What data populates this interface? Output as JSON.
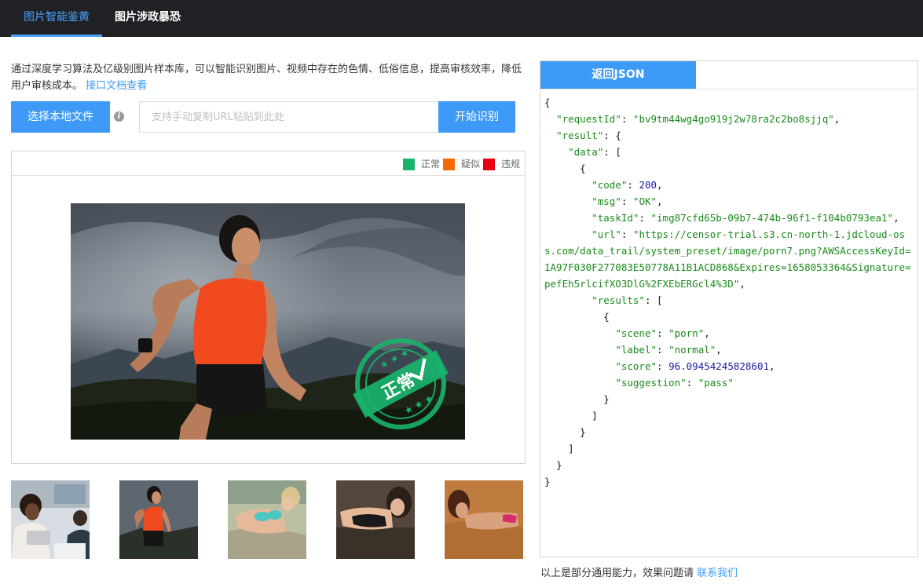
{
  "nav": {
    "tabs": [
      {
        "label": "图片智能鉴黄",
        "active": true
      },
      {
        "label": "图片涉政暴恐",
        "active": false
      }
    ]
  },
  "intro": {
    "text": "通过深度学习算法及亿级别图片样本库，可以智能识别图片、视频中存在的色情、低俗信息，提高审核效率，降低用户审核成本。",
    "link_label": "接口文档查看"
  },
  "controls": {
    "select_file_label": "选择本地文件",
    "info_icon_glyph": "i",
    "url_placeholder": "支持手动复制URL粘贴到此处",
    "url_value": "",
    "start_label": "开始识别"
  },
  "legend": {
    "normal": {
      "label": "正常",
      "color": "#19b36b"
    },
    "suspect": {
      "label": "疑似",
      "color": "#f56a00"
    },
    "violate": {
      "label": "违规",
      "color": "#e60012"
    }
  },
  "stamp": {
    "text": "正常",
    "color": "#19b36b"
  },
  "thumbnails": [
    "office-meeting",
    "runner-orange-top",
    "woman-lying-bra",
    "woman-lying-dark",
    "woman-lying-sand"
  ],
  "json_panel": {
    "tab_label": "返回JSON",
    "lines": [
      [
        {
          "t": "p",
          "v": "{"
        }
      ],
      [
        {
          "t": "p",
          "v": "  "
        },
        {
          "t": "s",
          "v": "\"requestId\""
        },
        {
          "t": "p",
          "v": ": "
        },
        {
          "t": "s",
          "v": "\"bv9tm44wg4go919j2w78ra2c2bo8sjjq\""
        },
        {
          "t": "p",
          "v": ","
        }
      ],
      [
        {
          "t": "p",
          "v": "  "
        },
        {
          "t": "s",
          "v": "\"result\""
        },
        {
          "t": "p",
          "v": ": {"
        }
      ],
      [
        {
          "t": "p",
          "v": "    "
        },
        {
          "t": "s",
          "v": "\"data\""
        },
        {
          "t": "p",
          "v": ": ["
        }
      ],
      [
        {
          "t": "p",
          "v": "      {"
        }
      ],
      [
        {
          "t": "p",
          "v": "        "
        },
        {
          "t": "s",
          "v": "\"code\""
        },
        {
          "t": "p",
          "v": ": "
        },
        {
          "t": "n",
          "v": "200"
        },
        {
          "t": "p",
          "v": ","
        }
      ],
      [
        {
          "t": "p",
          "v": "        "
        },
        {
          "t": "s",
          "v": "\"msg\""
        },
        {
          "t": "p",
          "v": ": "
        },
        {
          "t": "s",
          "v": "\"OK\""
        },
        {
          "t": "p",
          "v": ","
        }
      ],
      [
        {
          "t": "p",
          "v": "        "
        },
        {
          "t": "s",
          "v": "\"taskId\""
        },
        {
          "t": "p",
          "v": ": "
        },
        {
          "t": "s",
          "v": "\"img87cfd65b-09b7-474b-96f1-f104b0793ea1\""
        },
        {
          "t": "p",
          "v": ","
        }
      ],
      [
        {
          "t": "p",
          "v": "        "
        },
        {
          "t": "s",
          "v": "\"url\""
        },
        {
          "t": "p",
          "v": ": "
        },
        {
          "t": "s",
          "v": "\"https://censor-trial.s3.cn-north-1.jdcloud-oss.com/data_trail/system_preset/image/porn7.png?AWSAccessKeyId=1A97F030F277083E50778A11B1ACD868&Expires=1658053364&Signature=pefEh5rlcifXO3DlG%2FXEbERGcl4%3D\""
        },
        {
          "t": "p",
          "v": ","
        }
      ],
      [
        {
          "t": "p",
          "v": "        "
        },
        {
          "t": "s",
          "v": "\"results\""
        },
        {
          "t": "p",
          "v": ": ["
        }
      ],
      [
        {
          "t": "p",
          "v": "          {"
        }
      ],
      [
        {
          "t": "p",
          "v": "            "
        },
        {
          "t": "s",
          "v": "\"scene\""
        },
        {
          "t": "p",
          "v": ": "
        },
        {
          "t": "s",
          "v": "\"porn\""
        },
        {
          "t": "p",
          "v": ","
        }
      ],
      [
        {
          "t": "p",
          "v": "            "
        },
        {
          "t": "s",
          "v": "\"label\""
        },
        {
          "t": "p",
          "v": ": "
        },
        {
          "t": "s",
          "v": "\"normal\""
        },
        {
          "t": "p",
          "v": ","
        }
      ],
      [
        {
          "t": "p",
          "v": "            "
        },
        {
          "t": "s",
          "v": "\"score\""
        },
        {
          "t": "p",
          "v": ": "
        },
        {
          "t": "n",
          "v": "96.09454245828601"
        },
        {
          "t": "p",
          "v": ","
        }
      ],
      [
        {
          "t": "p",
          "v": "            "
        },
        {
          "t": "s",
          "v": "\"suggestion\""
        },
        {
          "t": "p",
          "v": ": "
        },
        {
          "t": "s",
          "v": "\"pass\""
        }
      ],
      [
        {
          "t": "p",
          "v": "          }"
        }
      ],
      [
        {
          "t": "p",
          "v": "        ]"
        }
      ],
      [
        {
          "t": "p",
          "v": "      }"
        }
      ],
      [
        {
          "t": "p",
          "v": "    ]"
        }
      ],
      [
        {
          "t": "p",
          "v": "  }"
        }
      ],
      [
        {
          "t": "p",
          "v": "}"
        }
      ]
    ]
  },
  "footer": {
    "text": "以上是部分通用能力，效果问题请",
    "link_label": "联系我们"
  }
}
